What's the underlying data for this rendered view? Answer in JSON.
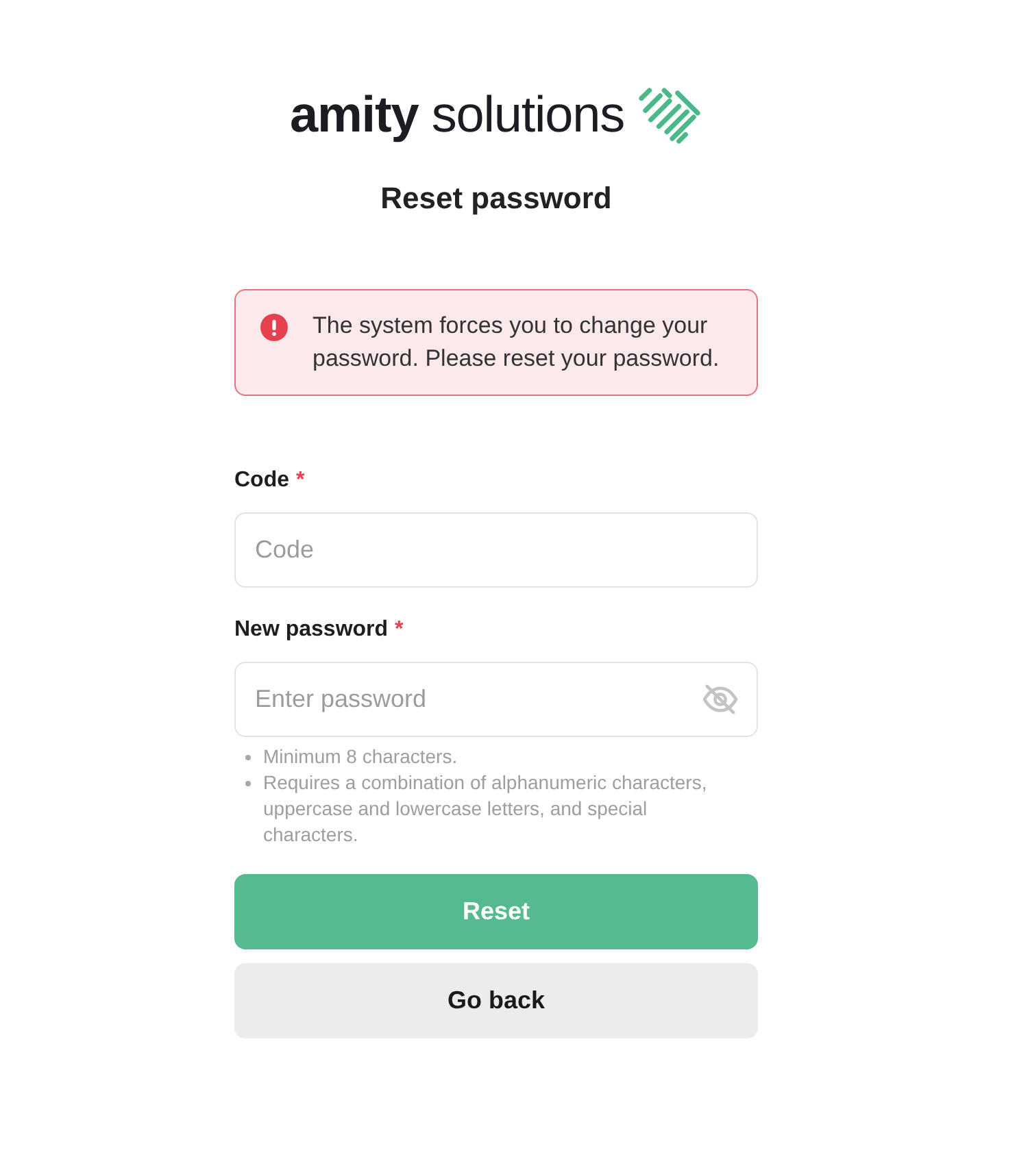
{
  "logo": {
    "wordmark": "**amity** solutions"
  },
  "title": "Reset password",
  "alert": {
    "kind": "error",
    "message": "The system forces you to change your password. Please reset your password."
  },
  "fields": [
    {
      "kind": "text",
      "label": "Code",
      "required_mark": "*",
      "placeholder": "Code"
    },
    {
      "kind": "password",
      "label": "New password",
      "required_mark": "*",
      "placeholder": "Enter password",
      "hints": [
        "Minimum 8 characters.",
        "Requires a combination of alphanumeric characters, uppercase and lowercase letters, and special characters."
      ]
    }
  ],
  "buttons": [
    {
      "kind": "primary",
      "label": "Reset"
    },
    {
      "kind": "secondary",
      "label": "Go back"
    }
  ]
}
